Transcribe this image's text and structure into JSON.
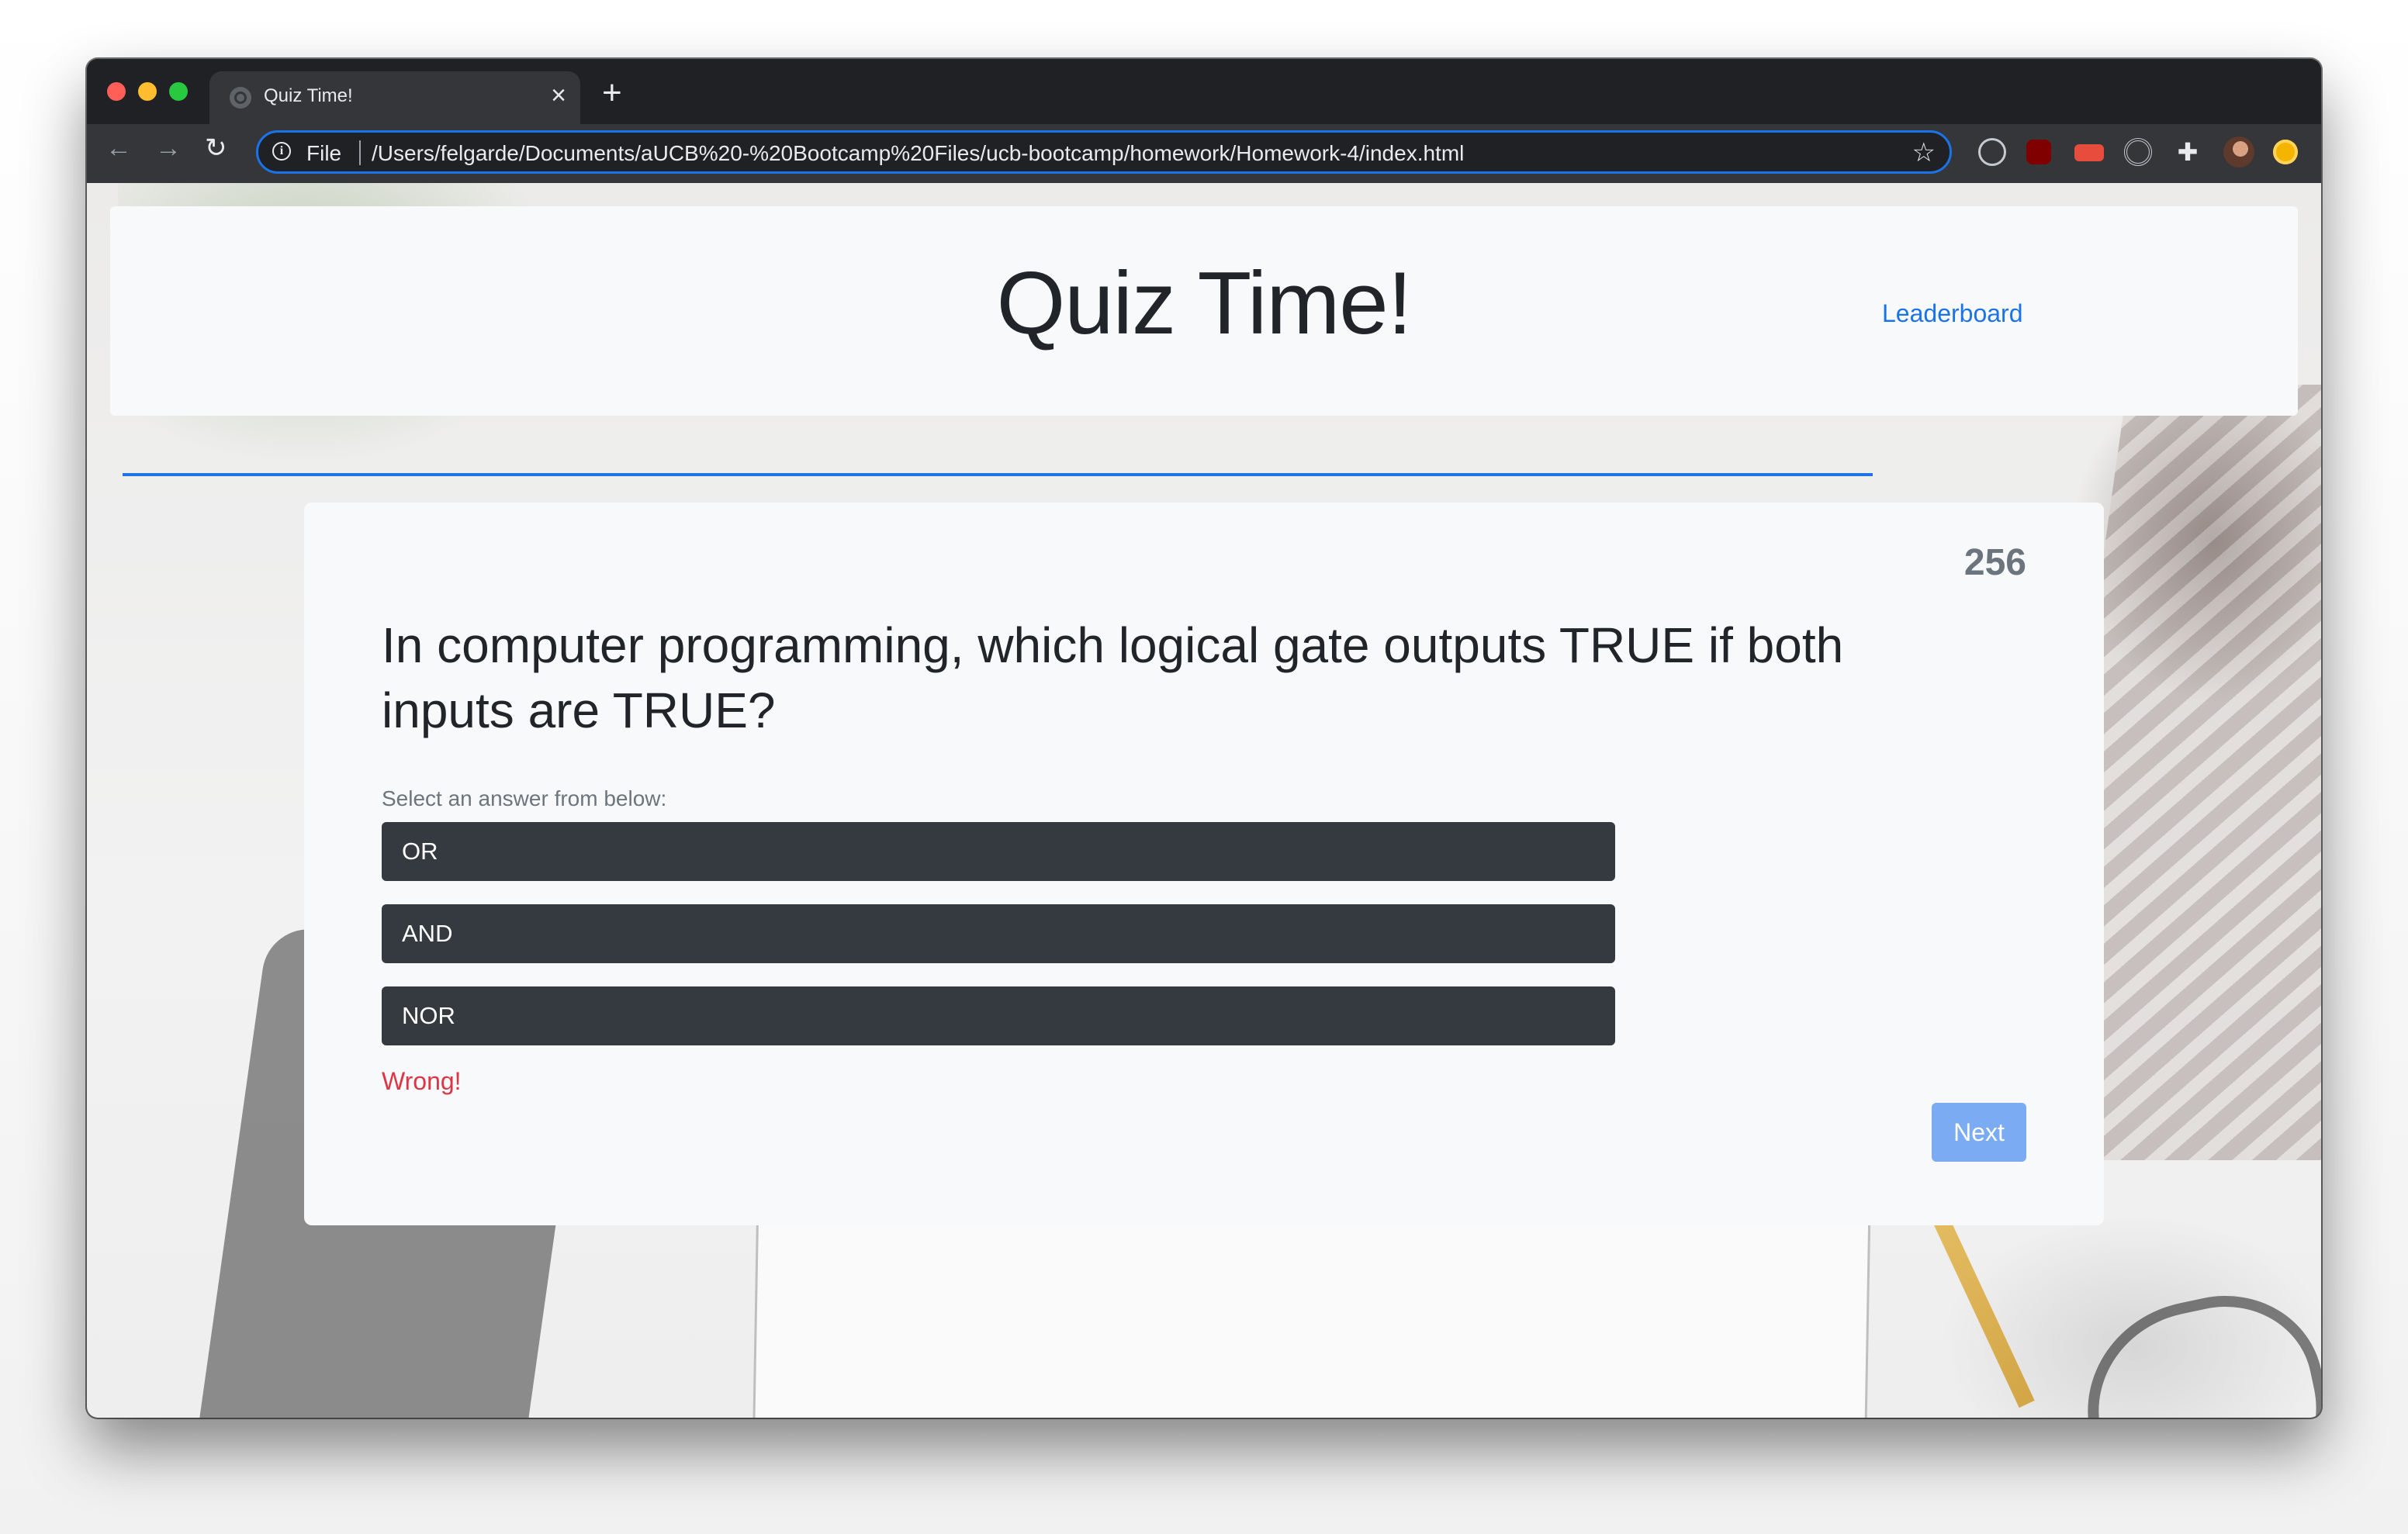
{
  "browser": {
    "tab_title": "Quiz Time!",
    "tab_close": "×",
    "new_tab": "+",
    "scheme_label": "File",
    "url": "/Users/felgarde/Documents/aUCB%20-%20Bootcamp%20Files/ucb-bootcamp/homework/Homework-4/index.html",
    "back_icon": "←",
    "forward_icon": "→",
    "reload_icon": "↻",
    "star_icon": "☆",
    "extension_icons": [
      "react-devtools-icon",
      "ublock-icon",
      "tag-icon",
      "target-icon",
      "puzzle-icon",
      "avatar-icon",
      "coin-icon"
    ]
  },
  "header": {
    "title": "Quiz Time!",
    "leaderboard_link": "Leaderboard",
    "progress_percent": 80
  },
  "quiz": {
    "timer": "256",
    "question": "In computer programming, which logical gate outputs TRUE if both inputs are TRUE?",
    "prompt": "Select an answer from below:",
    "answers": [
      "OR",
      "AND",
      "NOR"
    ],
    "feedback": "Wrong!",
    "next_label": "Next"
  },
  "colors": {
    "accent": "#1a73e8",
    "answer_bg": "#343a40",
    "feedback": "#dc3545",
    "next_button": "#7aabf3"
  }
}
